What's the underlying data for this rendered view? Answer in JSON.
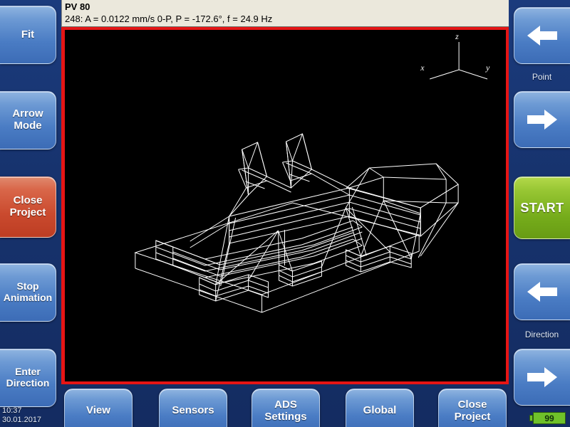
{
  "header": {
    "title": "PV 80",
    "readout": "248: A = 0.0122 mm/s 0-P, P = -172.6°, f = 24.9 Hz"
  },
  "left_rail": {
    "buttons": [
      {
        "id": "fit",
        "label": "Fit",
        "color": "blue"
      },
      {
        "id": "arrow-mode",
        "label": "Arrow\nMode",
        "color": "blue"
      },
      {
        "id": "close-project",
        "label": "Close\nProject",
        "color": "red"
      },
      {
        "id": "stop-animation",
        "label": "Stop\nAnimation",
        "color": "blue"
      },
      {
        "id": "enter-direction",
        "label": "Enter\nDirection",
        "color": "blue"
      }
    ],
    "fit_label": "Fit",
    "arrow_mode_label": "Arrow Mode",
    "arrow_mode_line1": "Arrow",
    "arrow_mode_line2": "Mode",
    "close_project_line1": "Close",
    "close_project_line2": "Project",
    "stop_animation_line1": "Stop",
    "stop_animation_line2": "Animation",
    "enter_direction_line1": "Enter",
    "enter_direction_line2": "Direction"
  },
  "right_rail": {
    "point_label": "Point",
    "direction_label": "Direction",
    "start_label": "START",
    "point_prev_icon": "arrow-left-icon",
    "point_next_icon": "arrow-right-icon",
    "direction_prev_icon": "arrow-left-icon",
    "direction_next_icon": "arrow-right-icon",
    "start_color": "#8cc122"
  },
  "toolbar": {
    "view_label": "View",
    "sensors_label": "Sensors",
    "ads_line1": "ADS",
    "ads_line2": "Settings",
    "global_label": "Global",
    "close_project_line1": "Close",
    "close_project_line2": "Project"
  },
  "status": {
    "time": "10:37",
    "date": "30.01.2017",
    "battery_level": "99"
  },
  "viewport": {
    "axis_x_label": "x",
    "axis_y_label": "y",
    "axis_z_label": "z",
    "background_color": "#000000",
    "border_color": "#e51515",
    "wireframe_color": "#ffffff"
  }
}
